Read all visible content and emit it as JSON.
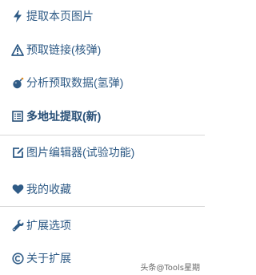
{
  "menu": {
    "items": [
      {
        "label": "提取本页图片",
        "icon": "lightning-icon"
      },
      {
        "label": "预取链接(核弹)",
        "icon": "warning-icon"
      },
      {
        "label": "分析预取数据(氢弹)",
        "icon": "bomb-icon"
      },
      {
        "label": "多地址提取(新)",
        "icon": "list-icon"
      },
      {
        "label": "图片编辑器(试验功能)",
        "icon": "edit-icon"
      },
      {
        "label": "我的收藏",
        "icon": "heart-icon"
      },
      {
        "label": "扩展选项",
        "icon": "wrench-icon"
      },
      {
        "label": "关于扩展",
        "icon": "copyright-icon"
      }
    ]
  },
  "watermark": "头条@Tools星期",
  "colors": {
    "text": "#2f5b86",
    "divider": "#d9d9d9",
    "background": "#ffffff"
  }
}
